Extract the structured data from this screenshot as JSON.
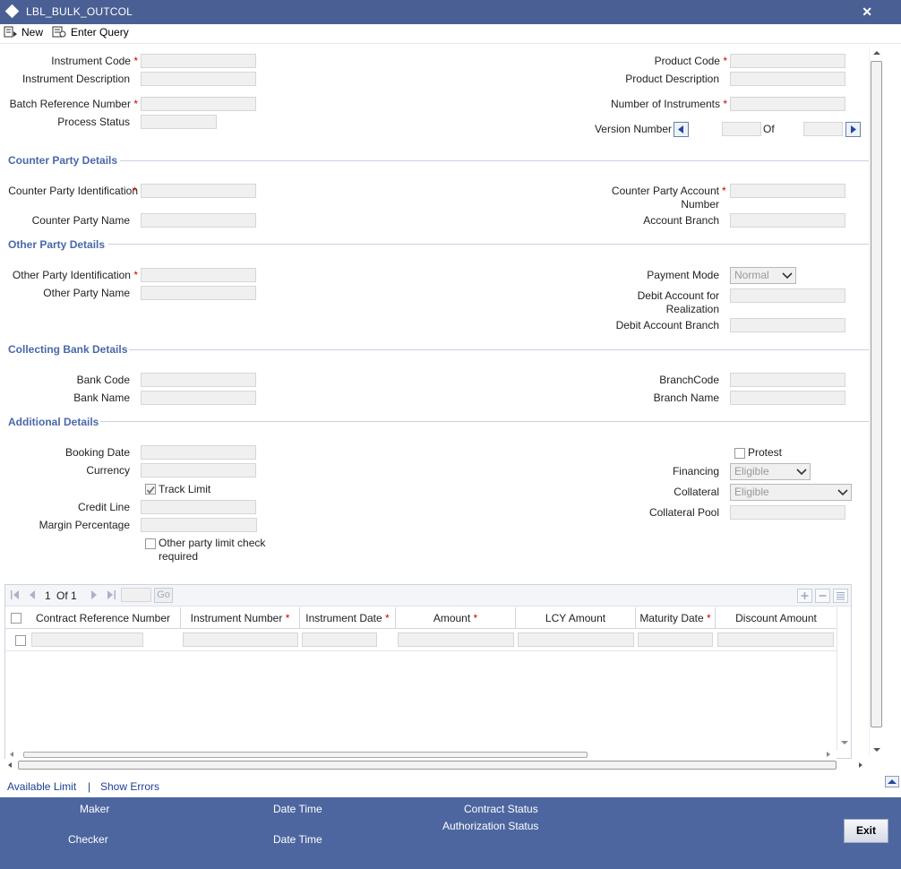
{
  "window": {
    "title": "LBL_BULK_OUTCOL",
    "close_glyph": "✕",
    "min_glyph": "▬"
  },
  "toolbar": {
    "new_label": "New",
    "enter_query_label": "Enter Query"
  },
  "header": {
    "instrument_code": "Instrument Code",
    "instrument_description": "Instrument Description",
    "batch_reference_number": "Batch Reference Number",
    "process_status": "Process Status",
    "product_code": "Product Code",
    "product_description": "Product Description",
    "number_of_instruments": "Number of Instruments",
    "version_number": "Version Number",
    "of": "Of",
    "required_mark": "*"
  },
  "counter_party": {
    "title": "Counter Party Details",
    "identification": "Counter Party Identification",
    "name": "Counter Party Name",
    "account_number": "Counter Party Account Number",
    "account_branch": "Account Branch"
  },
  "other_party": {
    "title": "Other Party Details",
    "identification": "Other Party Identification",
    "name": "Other Party Name",
    "payment_mode": "Payment Mode",
    "payment_mode_value": "Normal",
    "debit_account": "Debit Account for Realization",
    "debit_account_branch": "Debit Account Branch"
  },
  "collecting_bank": {
    "title": "Collecting Bank Details",
    "bank_code": "Bank Code",
    "bank_name": "Bank Name",
    "branch_code": "BranchCode",
    "branch_name": "Branch Name"
  },
  "additional": {
    "title": "Additional Details",
    "booking_date": "Booking Date",
    "currency": "Currency",
    "track_limit": "Track Limit",
    "credit_line": "Credit Line",
    "margin_percentage": "Margin Percentage",
    "other_party_limit_check": "Other party limit check required",
    "protest": "Protest",
    "financing": "Financing",
    "financing_value": "Eligible",
    "collateral": "Collateral",
    "collateral_value": "Eligible",
    "collateral_pool": "Collateral Pool"
  },
  "grid": {
    "pager_current": "1",
    "pager_of": "Of 1",
    "go_label": "Go",
    "columns": [
      {
        "label": "Contract Reference Number",
        "required": false
      },
      {
        "label": "Instrument Number",
        "required": true
      },
      {
        "label": "Instrument Date",
        "required": true
      },
      {
        "label": "Amount",
        "required": true
      },
      {
        "label": "LCY Amount",
        "required": false
      },
      {
        "label": "Maturity Date",
        "required": true
      },
      {
        "label": "Discount Amount",
        "required": false
      }
    ]
  },
  "links": {
    "available_limit": "Available Limit",
    "separator": "|",
    "show_errors": "Show Errors"
  },
  "footer": {
    "maker": "Maker",
    "checker": "Checker",
    "date_time_1": "Date Time",
    "date_time_2": "Date Time",
    "contract_status": "Contract Status",
    "authorization_status": "Authorization Status",
    "exit_label": "Exit"
  },
  "colors": {
    "titlebar": "#4a5f93",
    "section": "#4a68a8",
    "footer": "#4d66a0",
    "required": "#cc0000"
  }
}
